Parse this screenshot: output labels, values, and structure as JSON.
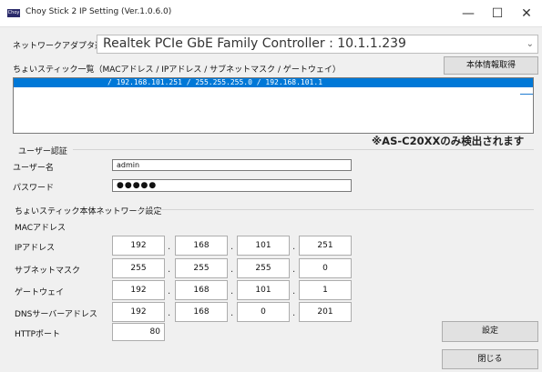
{
  "window": {
    "title": "Choy Stick 2 IP Setting (Ver.1.0.6.0)",
    "icon_text": "Choy"
  },
  "adapter": {
    "label": "ネットワークアダプタ選択",
    "selected": "Realtek PCIe GbE Family Controller : 10.1.1.239"
  },
  "list": {
    "header": "ちょいスティック一覧（MACアドレス / IPアドレス / サブネットマスク / ゲートウェイ）",
    "get_info_button": "本体情報取得",
    "rows": [
      "/ 192.168.101.251 / 255.255.255.0 / 192.168.101.1"
    ]
  },
  "notice": "※AS-C20XXのみ検出されます",
  "auth": {
    "group_label": "ユーザー認証",
    "username_label": "ユーザー名",
    "username_value": "admin",
    "password_label": "パスワード",
    "password_value": "●●●●●"
  },
  "network": {
    "group_label": "ちょいスティック本体ネットワーク設定",
    "mac_label": "MACアドレス",
    "ip_label": "IPアドレス",
    "ip": [
      "192",
      "168",
      "101",
      "251"
    ],
    "subnet_label": "サブネットマスク",
    "subnet": [
      "255",
      "255",
      "255",
      "0"
    ],
    "gateway_label": "ゲートウェイ",
    "gateway": [
      "192",
      "168",
      "101",
      "1"
    ],
    "dns_label": "DNSサーバーアドレス",
    "dns": [
      "192",
      "168",
      "0",
      "201"
    ],
    "http_port_label": "HTTPポート",
    "http_port": "80",
    "dot": "."
  },
  "buttons": {
    "set": "設定",
    "close": "閉じる"
  }
}
